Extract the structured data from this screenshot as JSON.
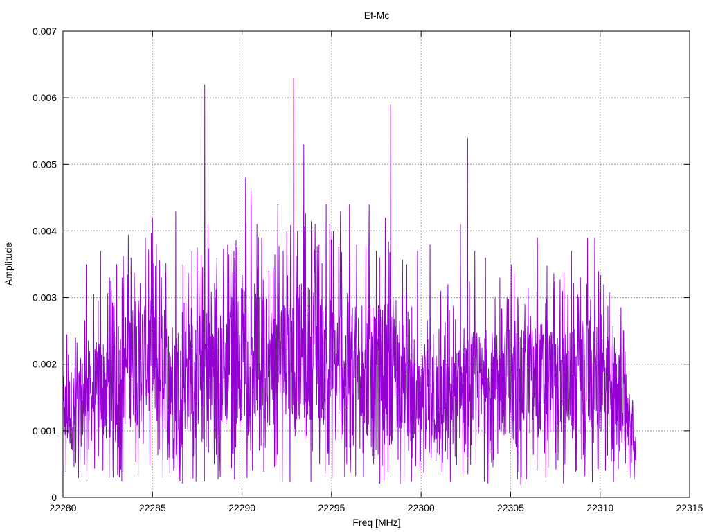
{
  "chart_data": {
    "type": "line",
    "title": "Ef-Mc",
    "xlabel": "Freq [MHz]",
    "ylabel": "Amplitude",
    "xlim": [
      22280,
      22315
    ],
    "ylim": [
      0,
      0.007
    ],
    "x_ticks": [
      "22280",
      "22285",
      "22290",
      "22295",
      "22300",
      "22305",
      "22310",
      "22315"
    ],
    "y_ticks": [
      "0",
      "0.001",
      "0.002",
      "0.003",
      "0.004",
      "0.005",
      "0.006",
      "0.007"
    ],
    "grid": true,
    "legend": "none",
    "series": [
      {
        "color": "#9400d3",
        "x_start": 22280,
        "x_end": 22312,
        "samples_per_mhz": 60,
        "envelope": [
          [
            22280.0,
            0.0013
          ],
          [
            22280.5,
            0.0014
          ],
          [
            22281.0,
            0.0015
          ],
          [
            22281.5,
            0.0016
          ],
          [
            22282.0,
            0.0017
          ],
          [
            22282.5,
            0.0018
          ],
          [
            22283.0,
            0.0019
          ],
          [
            22283.5,
            0.0021
          ],
          [
            22284.0,
            0.0021
          ],
          [
            22284.5,
            0.0022
          ],
          [
            22285.0,
            0.0021
          ],
          [
            22285.5,
            0.002
          ],
          [
            22286.0,
            0.0019
          ],
          [
            22286.5,
            0.0019
          ],
          [
            22287.0,
            0.0019
          ],
          [
            22287.5,
            0.002
          ],
          [
            22288.0,
            0.0021
          ],
          [
            22288.5,
            0.002
          ],
          [
            22289.0,
            0.002
          ],
          [
            22289.5,
            0.0021
          ],
          [
            22290.0,
            0.0023
          ],
          [
            22290.5,
            0.0024
          ],
          [
            22291.0,
            0.0022
          ],
          [
            22291.5,
            0.0021
          ],
          [
            22292.0,
            0.0021
          ],
          [
            22292.5,
            0.0022
          ],
          [
            22293.0,
            0.0023
          ],
          [
            22293.5,
            0.0023
          ],
          [
            22294.0,
            0.0023
          ],
          [
            22294.5,
            0.0022
          ],
          [
            22295.0,
            0.0022
          ],
          [
            22295.5,
            0.0021
          ],
          [
            22296.0,
            0.0021
          ],
          [
            22296.5,
            0.0021
          ],
          [
            22297.0,
            0.0021
          ],
          [
            22297.5,
            0.002
          ],
          [
            22298.0,
            0.0021
          ],
          [
            22298.5,
            0.002
          ],
          [
            22299.0,
            0.0019
          ],
          [
            22299.5,
            0.0015
          ],
          [
            22300.0,
            0.0014
          ],
          [
            22300.5,
            0.0015
          ],
          [
            22301.0,
            0.0015
          ],
          [
            22301.5,
            0.0015
          ],
          [
            22302.0,
            0.0016
          ],
          [
            22302.5,
            0.0017
          ],
          [
            22303.0,
            0.0018
          ],
          [
            22303.5,
            0.0017
          ],
          [
            22304.0,
            0.0017
          ],
          [
            22304.5,
            0.0018
          ],
          [
            22305.0,
            0.0019
          ],
          [
            22305.5,
            0.0018
          ],
          [
            22306.0,
            0.0018
          ],
          [
            22306.5,
            0.0019
          ],
          [
            22307.0,
            0.0019
          ],
          [
            22307.5,
            0.0018
          ],
          [
            22308.0,
            0.0018
          ],
          [
            22308.5,
            0.0018
          ],
          [
            22309.0,
            0.0019
          ],
          [
            22309.5,
            0.0019
          ],
          [
            22310.0,
            0.0019
          ],
          [
            22310.5,
            0.0017
          ],
          [
            22311.0,
            0.0016
          ],
          [
            22311.5,
            0.0014
          ],
          [
            22312.0,
            0.0009
          ]
        ],
        "peaks": [
          [
            22280.1,
            0.00135
          ],
          [
            22281.3,
            0.0035
          ],
          [
            22282.1,
            0.0037
          ],
          [
            22282.6,
            0.0033
          ],
          [
            22283.0,
            0.0035
          ],
          [
            22283.3,
            0.0033
          ],
          [
            22283.8,
            0.0036
          ],
          [
            22284.6,
            0.0039
          ],
          [
            22285.0,
            0.0042
          ],
          [
            22285.5,
            0.0033
          ],
          [
            22286.3,
            0.0043
          ],
          [
            22286.7,
            0.0035
          ],
          [
            22287.2,
            0.0037
          ],
          [
            22287.6,
            0.0034
          ],
          [
            22287.92,
            0.0062
          ],
          [
            22288.1,
            0.0041
          ],
          [
            22288.6,
            0.0036
          ],
          [
            22289.2,
            0.0038
          ],
          [
            22289.6,
            0.0036
          ],
          [
            22290.2,
            0.0048
          ],
          [
            22290.5,
            0.0046
          ],
          [
            22291.1,
            0.0039
          ],
          [
            22291.5,
            0.0034
          ],
          [
            22292.0,
            0.0044
          ],
          [
            22292.3,
            0.0037
          ],
          [
            22292.5,
            0.004
          ],
          [
            22292.88,
            0.0063
          ],
          [
            22293.1,
            0.004
          ],
          [
            22293.45,
            0.0053
          ],
          [
            22293.9,
            0.004
          ],
          [
            22294.3,
            0.0038
          ],
          [
            22294.7,
            0.0044
          ],
          [
            22295.1,
            0.004
          ],
          [
            22295.5,
            0.0043
          ],
          [
            22296.0,
            0.0044
          ],
          [
            22296.4,
            0.0038
          ],
          [
            22297.1,
            0.0044
          ],
          [
            22297.5,
            0.0037
          ],
          [
            22298.0,
            0.0042
          ],
          [
            22298.3,
            0.0059
          ],
          [
            22299.2,
            0.0035
          ],
          [
            22299.8,
            0.0037
          ],
          [
            22300.5,
            0.0038
          ],
          [
            22301.1,
            0.0031
          ],
          [
            22301.5,
            0.0032
          ],
          [
            22302.2,
            0.0041
          ],
          [
            22302.6,
            0.0054
          ],
          [
            22303.0,
            0.0037
          ],
          [
            22303.6,
            0.0036
          ],
          [
            22304.4,
            0.0033
          ],
          [
            22304.8,
            0.003
          ],
          [
            22305.4,
            0.003
          ],
          [
            22305.8,
            0.0029
          ],
          [
            22306.5,
            0.0039
          ],
          [
            22307.0,
            0.003
          ],
          [
            22307.4,
            0.003
          ],
          [
            22307.9,
            0.0031
          ],
          [
            22308.4,
            0.0037
          ],
          [
            22308.9,
            0.0033
          ],
          [
            22309.3,
            0.0039
          ],
          [
            22309.7,
            0.0039
          ],
          [
            22310.2,
            0.0032
          ],
          [
            22310.8,
            0.0024
          ],
          [
            22311.3,
            0.0025
          ],
          [
            22311.8,
            0.0013
          ]
        ]
      }
    ]
  }
}
